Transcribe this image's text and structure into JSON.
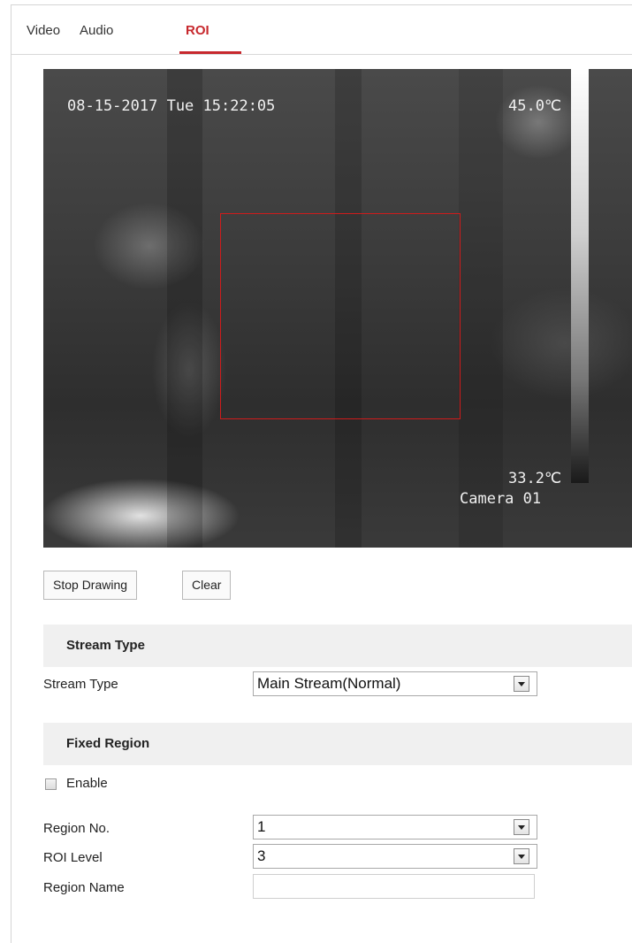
{
  "tabs": [
    {
      "label": "Video",
      "active": false
    },
    {
      "label": "Audio",
      "active": false
    },
    {
      "label": "ROI",
      "active": true
    }
  ],
  "video": {
    "datetime": "08-15-2017 Tue 15:22:05",
    "max_temp": "45.0℃",
    "min_temp": "33.2℃",
    "camera_name": "Camera 01"
  },
  "buttons": {
    "stop_drawing": "Stop Drawing",
    "clear": "Clear"
  },
  "stream_section": {
    "header": "Stream Type",
    "label": "Stream Type",
    "value": "Main Stream(Normal)"
  },
  "fixed_region": {
    "header": "Fixed Region",
    "enable_label": "Enable",
    "enable_checked": false,
    "region_no_label": "Region No.",
    "region_no_value": "1",
    "roi_level_label": "ROI Level",
    "roi_level_value": "3",
    "region_name_label": "Region Name",
    "region_name_value": ""
  },
  "colors": {
    "accent": "#c7282d",
    "roi_rect": "#d01b1b",
    "section_bg": "#f0f0f0"
  }
}
